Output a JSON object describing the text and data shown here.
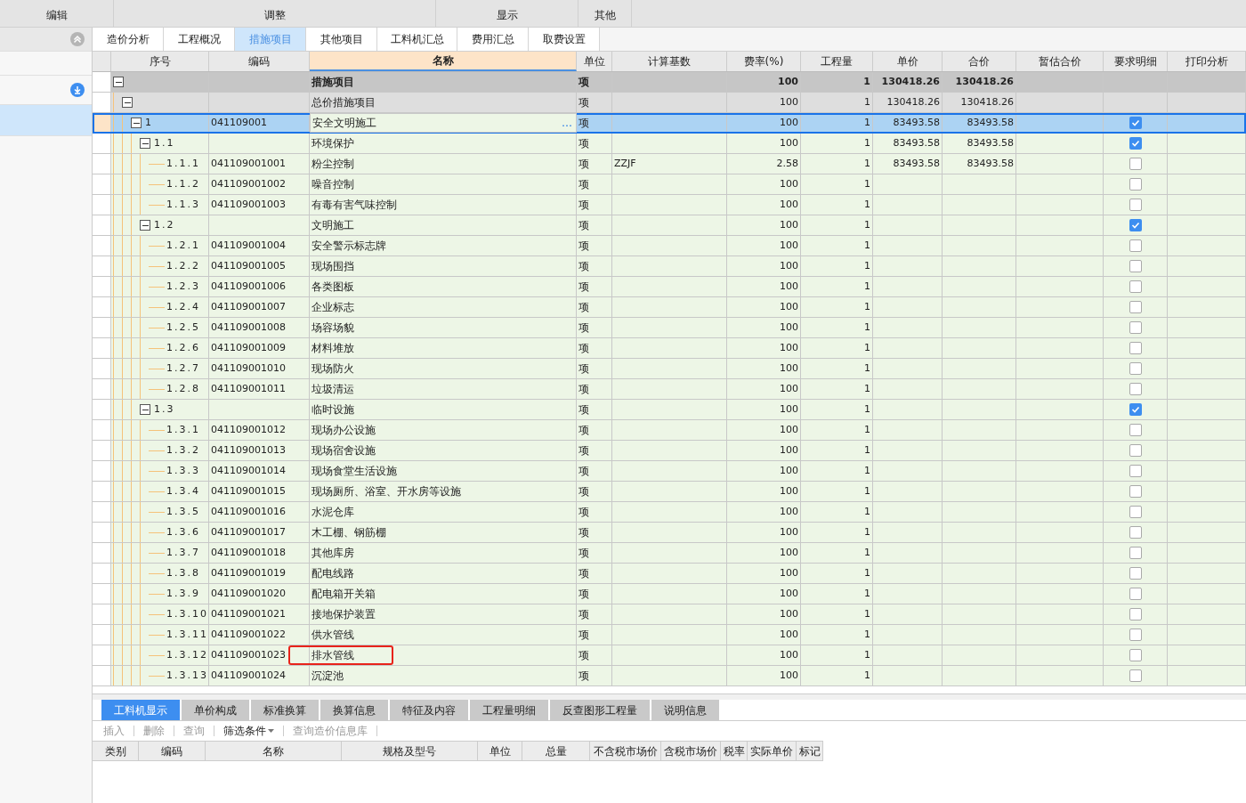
{
  "menu": [
    {
      "label": "编辑"
    },
    {
      "label": "调整"
    },
    {
      "label": "显示"
    },
    {
      "label": "其他"
    }
  ],
  "sidebar": {
    "items": [
      {
        "selected": false
      },
      {
        "selected": false
      },
      {
        "selected": false
      },
      {
        "selected": true
      }
    ]
  },
  "tabs": [
    {
      "label": "造价分析",
      "selected": false
    },
    {
      "label": "工程概况",
      "selected": false
    },
    {
      "label": "措施项目",
      "selected": true
    },
    {
      "label": "其他项目",
      "selected": false
    },
    {
      "label": "工料机汇总",
      "selected": false
    },
    {
      "label": "费用汇总",
      "selected": false
    },
    {
      "label": "取费设置",
      "selected": false
    }
  ],
  "table": {
    "columns": [
      {
        "label": "序号",
        "selected": false
      },
      {
        "label": "编码",
        "selected": false
      },
      {
        "label": "名称",
        "selected": true
      },
      {
        "label": "单位",
        "selected": false
      },
      {
        "label": "计算基数",
        "selected": false
      },
      {
        "label": "费率(%)",
        "selected": false
      },
      {
        "label": "工程量",
        "selected": false
      },
      {
        "label": "单价",
        "selected": false
      },
      {
        "label": "合价",
        "selected": false
      },
      {
        "label": "暂估合价",
        "selected": false
      },
      {
        "label": "要求明细",
        "selected": false
      },
      {
        "label": "打印分析",
        "selected": false
      }
    ],
    "rows": [
      {
        "kind": "root",
        "name": "措施项目",
        "unit": "项",
        "rate": "100",
        "qty": "1",
        "price": "130418.26",
        "total": "130418.26",
        "expanded": true,
        "selected": false,
        "outlined": false,
        "children": [
          {
            "kind": "group",
            "name": "总价措施项目",
            "unit": "项",
            "rate": "100",
            "qty": "1",
            "price": "130418.26",
            "total": "130418.26",
            "expanded": true,
            "selected": false,
            "outlined": false,
            "children": [
              {
                "kind": "item",
                "seq": "1",
                "code": "041109001",
                "name": "安全文明施工",
                "unit": "项",
                "rate": "100",
                "qty": "1",
                "price": "83493.58",
                "total": "83493.58",
                "expanded": true,
                "checked": true,
                "selected": true,
                "outlined": false,
                "ellipsis": "…",
                "children": [
                  {
                    "kind": "item",
                    "seq": "1.1",
                    "name": "环境保护",
                    "unit": "项",
                    "rate": "100",
                    "qty": "1",
                    "price": "83493.58",
                    "total": "83493.58",
                    "expanded": true,
                    "checked": true,
                    "selected": false,
                    "outlined": false,
                    "children": [
                      {
                        "kind": "item",
                        "seq": "1.1.1",
                        "code": "041109001001",
                        "name": "粉尘控制",
                        "unit": "项",
                        "base": "ZZJF",
                        "rate": "2.58",
                        "qty": "1",
                        "price": "83493.58",
                        "total": "83493.58",
                        "checked": false,
                        "selected": false,
                        "outlined": false
                      },
                      {
                        "kind": "item",
                        "seq": "1.1.2",
                        "code": "041109001002",
                        "name": "噪音控制",
                        "unit": "项",
                        "rate": "100",
                        "qty": "1",
                        "checked": false,
                        "selected": false,
                        "outlined": false
                      },
                      {
                        "kind": "item",
                        "seq": "1.1.3",
                        "code": "041109001003",
                        "name": "有毒有害气味控制",
                        "unit": "项",
                        "rate": "100",
                        "qty": "1",
                        "checked": false,
                        "selected": false,
                        "outlined": false
                      }
                    ]
                  },
                  {
                    "kind": "item",
                    "seq": "1.2",
                    "name": "文明施工",
                    "unit": "项",
                    "rate": "100",
                    "qty": "1",
                    "expanded": true,
                    "checked": true,
                    "selected": false,
                    "outlined": false,
                    "children": [
                      {
                        "kind": "item",
                        "seq": "1.2.1",
                        "code": "041109001004",
                        "name": "安全警示标志牌",
                        "unit": "项",
                        "rate": "100",
                        "qty": "1",
                        "checked": false,
                        "selected": false,
                        "outlined": false
                      },
                      {
                        "kind": "item",
                        "seq": "1.2.2",
                        "code": "041109001005",
                        "name": "现场围挡",
                        "unit": "项",
                        "rate": "100",
                        "qty": "1",
                        "checked": false,
                        "selected": false,
                        "outlined": false
                      },
                      {
                        "kind": "item",
                        "seq": "1.2.3",
                        "code": "041109001006",
                        "name": "各类图板",
                        "unit": "项",
                        "rate": "100",
                        "qty": "1",
                        "checked": false,
                        "selected": false,
                        "outlined": false
                      },
                      {
                        "kind": "item",
                        "seq": "1.2.4",
                        "code": "041109001007",
                        "name": "企业标志",
                        "unit": "项",
                        "rate": "100",
                        "qty": "1",
                        "checked": false,
                        "selected": false,
                        "outlined": false
                      },
                      {
                        "kind": "item",
                        "seq": "1.2.5",
                        "code": "041109001008",
                        "name": "场容场貌",
                        "unit": "项",
                        "rate": "100",
                        "qty": "1",
                        "checked": false,
                        "selected": false,
                        "outlined": false
                      },
                      {
                        "kind": "item",
                        "seq": "1.2.6",
                        "code": "041109001009",
                        "name": "材料堆放",
                        "unit": "项",
                        "rate": "100",
                        "qty": "1",
                        "checked": false,
                        "selected": false,
                        "outlined": false
                      },
                      {
                        "kind": "item",
                        "seq": "1.2.7",
                        "code": "041109001010",
                        "name": "现场防火",
                        "unit": "项",
                        "rate": "100",
                        "qty": "1",
                        "checked": false,
                        "selected": false,
                        "outlined": false
                      },
                      {
                        "kind": "item",
                        "seq": "1.2.8",
                        "code": "041109001011",
                        "name": "垃圾清运",
                        "unit": "项",
                        "rate": "100",
                        "qty": "1",
                        "checked": false,
                        "selected": false,
                        "outlined": false
                      }
                    ]
                  },
                  {
                    "kind": "item",
                    "seq": "1.3",
                    "name": "临时设施",
                    "unit": "项",
                    "rate": "100",
                    "qty": "1",
                    "expanded": true,
                    "checked": true,
                    "selected": false,
                    "outlined": false,
                    "children": [
                      {
                        "kind": "item",
                        "seq": "1.3.1",
                        "code": "041109001012",
                        "name": "现场办公设施",
                        "unit": "项",
                        "rate": "100",
                        "qty": "1",
                        "checked": false,
                        "selected": false,
                        "outlined": false
                      },
                      {
                        "kind": "item",
                        "seq": "1.3.2",
                        "code": "041109001013",
                        "name": "现场宿舍设施",
                        "unit": "项",
                        "rate": "100",
                        "qty": "1",
                        "checked": false,
                        "selected": false,
                        "outlined": false
                      },
                      {
                        "kind": "item",
                        "seq": "1.3.3",
                        "code": "041109001014",
                        "name": "现场食堂生活设施",
                        "unit": "项",
                        "rate": "100",
                        "qty": "1",
                        "checked": false,
                        "selected": false,
                        "outlined": false
                      },
                      {
                        "kind": "item",
                        "seq": "1.3.4",
                        "code": "041109001015",
                        "name": "现场厕所、浴室、开水房等设施",
                        "unit": "项",
                        "rate": "100",
                        "qty": "1",
                        "checked": false,
                        "selected": false,
                        "outlined": false
                      },
                      {
                        "kind": "item",
                        "seq": "1.3.5",
                        "code": "041109001016",
                        "name": "水泥仓库",
                        "unit": "项",
                        "rate": "100",
                        "qty": "1",
                        "checked": false,
                        "selected": false,
                        "outlined": false
                      },
                      {
                        "kind": "item",
                        "seq": "1.3.6",
                        "code": "041109001017",
                        "name": "木工棚、钢筋棚",
                        "unit": "项",
                        "rate": "100",
                        "qty": "1",
                        "checked": false,
                        "selected": false,
                        "outlined": false
                      },
                      {
                        "kind": "item",
                        "seq": "1.3.7",
                        "code": "041109001018",
                        "name": "其他库房",
                        "unit": "项",
                        "rate": "100",
                        "qty": "1",
                        "checked": false,
                        "selected": false,
                        "outlined": false
                      },
                      {
                        "kind": "item",
                        "seq": "1.3.8",
                        "code": "041109001019",
                        "name": "配电线路",
                        "unit": "项",
                        "rate": "100",
                        "qty": "1",
                        "checked": false,
                        "selected": false,
                        "outlined": false
                      },
                      {
                        "kind": "item",
                        "seq": "1.3.9",
                        "code": "041109001020",
                        "name": "配电箱开关箱",
                        "unit": "项",
                        "rate": "100",
                        "qty": "1",
                        "checked": false,
                        "selected": false,
                        "outlined": false
                      },
                      {
                        "kind": "item",
                        "seq": "1.3.10",
                        "code": "041109001021",
                        "name": "接地保护装置",
                        "unit": "项",
                        "rate": "100",
                        "qty": "1",
                        "checked": false,
                        "selected": false,
                        "outlined": false
                      },
                      {
                        "kind": "item",
                        "seq": "1.3.11",
                        "code": "041109001022",
                        "name": "供水管线",
                        "unit": "项",
                        "rate": "100",
                        "qty": "1",
                        "checked": false,
                        "selected": false,
                        "outlined": false
                      },
                      {
                        "kind": "item",
                        "seq": "1.3.12",
                        "code": "041109001023",
                        "name": "排水管线",
                        "unit": "项",
                        "rate": "100",
                        "qty": "1",
                        "checked": false,
                        "selected": false,
                        "outlined": true
                      },
                      {
                        "kind": "item",
                        "seq": "1.3.13",
                        "code": "041109001024",
                        "name": "沉淀池",
                        "unit": "项",
                        "rate": "100",
                        "qty": "1",
                        "checked": false,
                        "selected": false,
                        "outlined": false
                      }
                    ]
                  }
                ]
              }
            ]
          }
        ]
      }
    ]
  },
  "bottom_tabs": [
    {
      "label": "工料机显示",
      "selected": true
    },
    {
      "label": "单价构成",
      "selected": false
    },
    {
      "label": "标准换算",
      "selected": false
    },
    {
      "label": "换算信息",
      "selected": false
    },
    {
      "label": "特征及内容",
      "selected": false
    },
    {
      "label": "工程量明细",
      "selected": false
    },
    {
      "label": "反查图形工程量",
      "selected": false
    },
    {
      "label": "说明信息",
      "selected": false
    }
  ],
  "toolbar": [
    {
      "label": "插入",
      "disabled": true,
      "dropdown": false
    },
    {
      "label": "删除",
      "disabled": true,
      "dropdown": false
    },
    {
      "label": "查询",
      "disabled": true,
      "dropdown": false
    },
    {
      "label": "筛选条件",
      "disabled": false,
      "dropdown": true
    },
    {
      "label": "查询造价信息库",
      "disabled": true,
      "dropdown": false
    }
  ],
  "bottom_columns": [
    "类别",
    "编码",
    "名称",
    "规格及型号",
    "单位",
    "总量",
    "不含税市场价",
    "含税市场价",
    "税率",
    "实际单价",
    "标记"
  ]
}
